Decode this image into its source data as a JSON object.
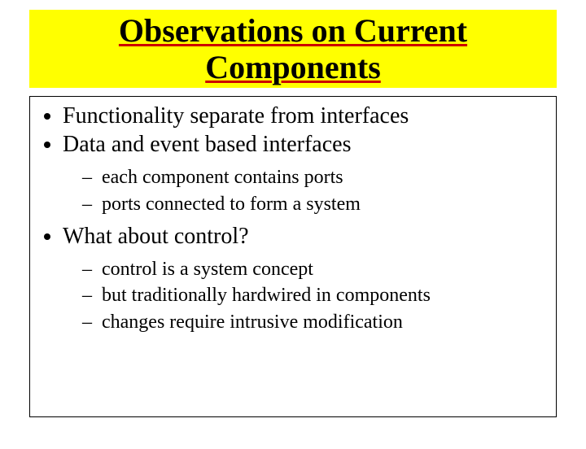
{
  "slide": {
    "title": "Observations on Current Components",
    "bullets": {
      "b1": "Functionality separate from interfaces",
      "b2": "Data and event based interfaces",
      "b2_sub": {
        "s1": "each component contains ports",
        "s2": "ports connected to form a system"
      },
      "b3": "What about control?",
      "b3_sub": {
        "s1": "control is a system concept",
        "s2": "but traditionally hardwired in components",
        "s3": "changes require intrusive modification"
      }
    }
  }
}
